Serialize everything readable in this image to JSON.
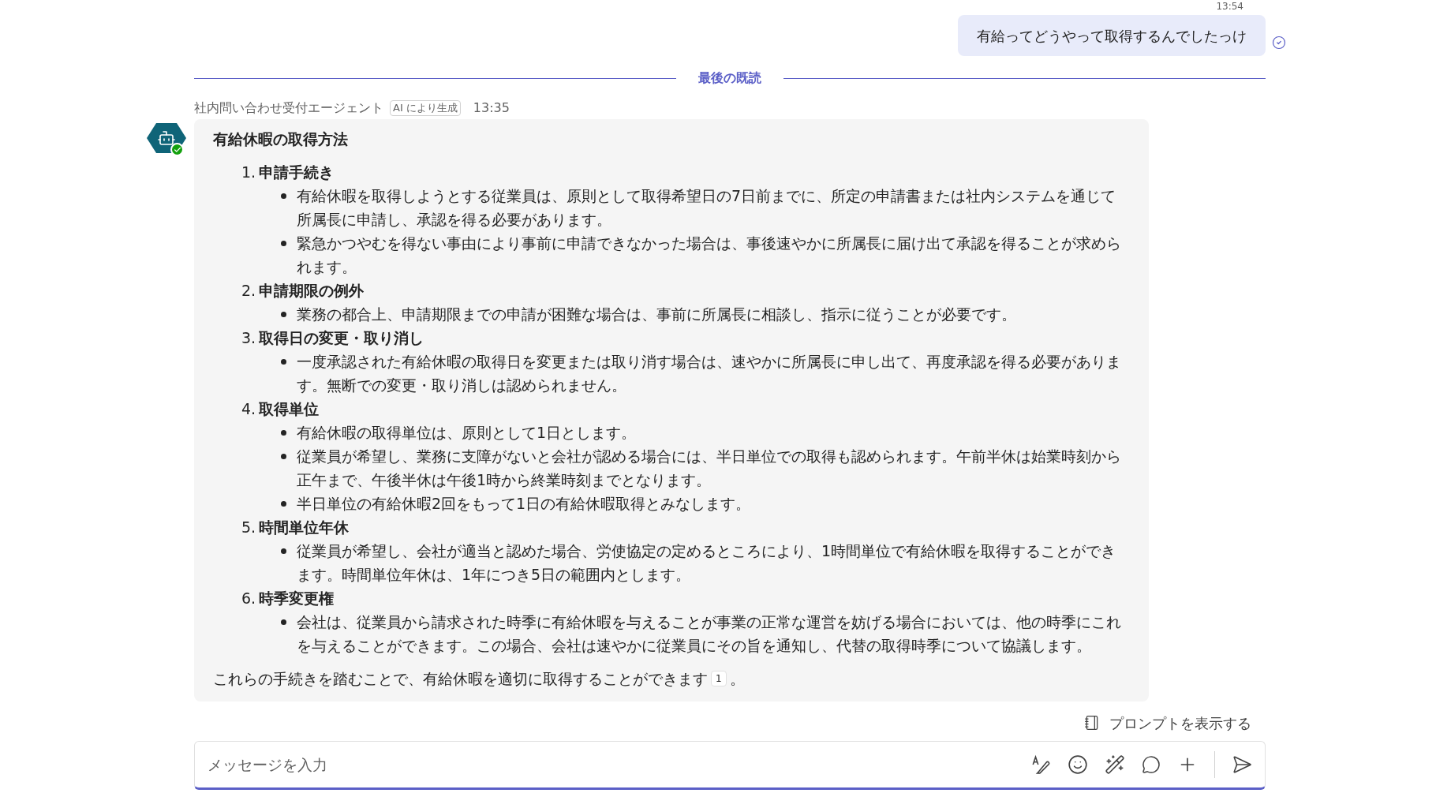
{
  "header_time": "13:54",
  "user_message": {
    "text": "有給ってどうやって取得するんでしたっけ"
  },
  "last_read_divider": "最後の既読",
  "bot_message": {
    "sender": "社内問い合わせ受付エージェント",
    "badge": "AI により生成",
    "time": "13:35",
    "title": "有給休暇の取得方法",
    "sections": [
      {
        "number": "1.",
        "heading": "申請手続き",
        "bullets": [
          "有給休暇を取得しようとする従業員は、原則として取得希望日の7日前までに、所定の申請書または社内システムを通じて所属長に申請し、承認を得る必要があります。",
          "緊急かつやむを得ない事由により事前に申請できなかった場合は、事後速やかに所属長に届け出て承認を得ることが求められます。"
        ]
      },
      {
        "number": "2.",
        "heading": "申請期限の例外",
        "bullets": [
          "業務の都合上、申請期限までの申請が困難な場合は、事前に所属長に相談し、指示に従うことが必要です。"
        ]
      },
      {
        "number": "3.",
        "heading": "取得日の変更・取り消し",
        "bullets": [
          "一度承認された有給休暇の取得日を変更または取り消す場合は、速やかに所属長に申し出て、再度承認を得る必要があります。無断での変更・取り消しは認められません。"
        ]
      },
      {
        "number": "4.",
        "heading": "取得単位",
        "bullets": [
          "有給休暇の取得単位は、原則として1日とします。",
          "従業員が希望し、業務に支障がないと会社が認める場合には、半日単位での取得も認められます。午前半休は始業時刻から正午まで、午後半休は午後1時から終業時刻までとなります。",
          "半日単位の有給休暇2回をもって1日の有給休暇取得とみなします。"
        ]
      },
      {
        "number": "5.",
        "heading": "時間単位年休",
        "bullets": [
          "従業員が希望し、会社が適当と認めた場合、労使協定の定めるところにより、1時間単位で有給休暇を取得することができます。時間単位年休は、1年につき5日の範囲内とします。"
        ]
      },
      {
        "number": "6.",
        "heading": "時季変更権",
        "bullets": [
          "会社は、従業員から請求された時季に有給休暇を与えることが事業の正常な運営を妨げる場合においては、他の時季にこれを与えることができます。この場合、会社は速やかに従業員にその旨を通知し、代替の取得時季について協議します。"
        ]
      }
    ],
    "conclusion": "これらの手続きを踏むことで、有給休暇を適切に取得することができます",
    "citation": "1",
    "conclusion_end": "。"
  },
  "prompt_button": "プロンプトを表示する",
  "composer": {
    "placeholder": "メッセージを入力"
  }
}
